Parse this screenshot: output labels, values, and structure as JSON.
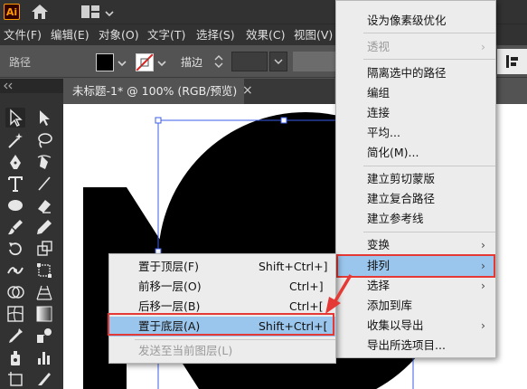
{
  "app": {
    "logo_text": "Ai"
  },
  "menubar": {
    "items": [
      "文件(F)",
      "编辑(E)",
      "对象(O)",
      "文字(T)",
      "选择(S)",
      "效果(C)",
      "视图(V)"
    ]
  },
  "control_bar": {
    "path_label": "路径",
    "stroke_label": "描边"
  },
  "document": {
    "tab_title": "未标题-1* @ 100% (RGB/预览)",
    "close_glyph": "×"
  },
  "canvas": {
    "shape_color": "#000000",
    "selection_color": "#3b5de8"
  },
  "context_menu": {
    "items": [
      {
        "label": "设为像素级优化"
      },
      {
        "label": "透视",
        "disabled": true,
        "submenu": true
      },
      {
        "label": "隔离选中的路径"
      },
      {
        "label": "编组"
      },
      {
        "label": "连接"
      },
      {
        "label": "平均..."
      },
      {
        "label": "简化(M)..."
      },
      {
        "label": "建立剪切蒙版"
      },
      {
        "label": "建立复合路径"
      },
      {
        "label": "建立参考线"
      },
      {
        "label": "变换",
        "submenu": true
      },
      {
        "label": "排列",
        "submenu": true,
        "highlighted": true
      },
      {
        "label": "选择",
        "submenu": true
      },
      {
        "label": "添加到库"
      },
      {
        "label": "收集以导出",
        "submenu": true
      },
      {
        "label": "导出所选项目..."
      }
    ]
  },
  "arrange_submenu": {
    "items": [
      {
        "label": "置于顶层(F)",
        "shortcut": "Shift+Ctrl+]"
      },
      {
        "label": "前移一层(O)",
        "shortcut": "Ctrl+]"
      },
      {
        "label": "后移一层(B)",
        "shortcut": "Ctrl+["
      },
      {
        "label": "置于底层(A)",
        "shortcut": "Shift+Ctrl+[",
        "highlighted": true
      },
      {
        "label": "发送至当前图层(L)",
        "disabled": true
      }
    ]
  },
  "colors": {
    "highlight": "#9ac5ec",
    "annotation_red": "#e53935",
    "app_dark": "#323232",
    "panel": "#535353"
  }
}
